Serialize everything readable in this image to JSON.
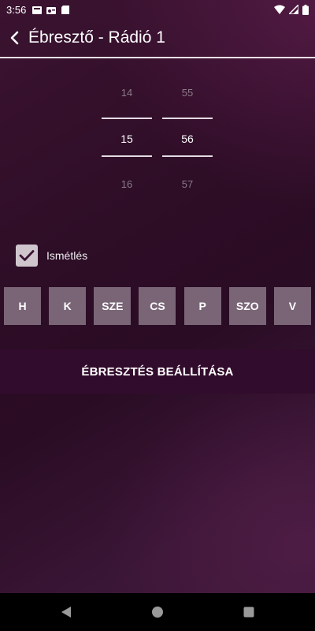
{
  "status_bar": {
    "time": "3:56",
    "notification_icons": [
      "card-icon",
      "radio-icon",
      "sd-card-icon"
    ],
    "system_icons": [
      "wifi-icon",
      "signal-icon",
      "battery-icon"
    ]
  },
  "toolbar": {
    "title": "Ébresztő - Rádió 1",
    "back_icon": "back-arrow-icon"
  },
  "time_picker": {
    "hour": {
      "prev": "14",
      "current": "15",
      "next": "16"
    },
    "minute": {
      "prev": "55",
      "current": "56",
      "next": "57"
    }
  },
  "repeat": {
    "label": "Ismétlés",
    "checked": true
  },
  "days": [
    "H",
    "K",
    "SZE",
    "CS",
    "P",
    "SZO",
    "V"
  ],
  "set_alarm_label": "ÉBRESZTÉS BEÁLLÍTÁSA",
  "colors": {
    "day_button": "#7a6577",
    "set_alarm_bg": "#320c2c",
    "checkbox": "#cfc6cd"
  },
  "nav_bar": [
    "back-icon",
    "home-icon",
    "recents-icon"
  ]
}
